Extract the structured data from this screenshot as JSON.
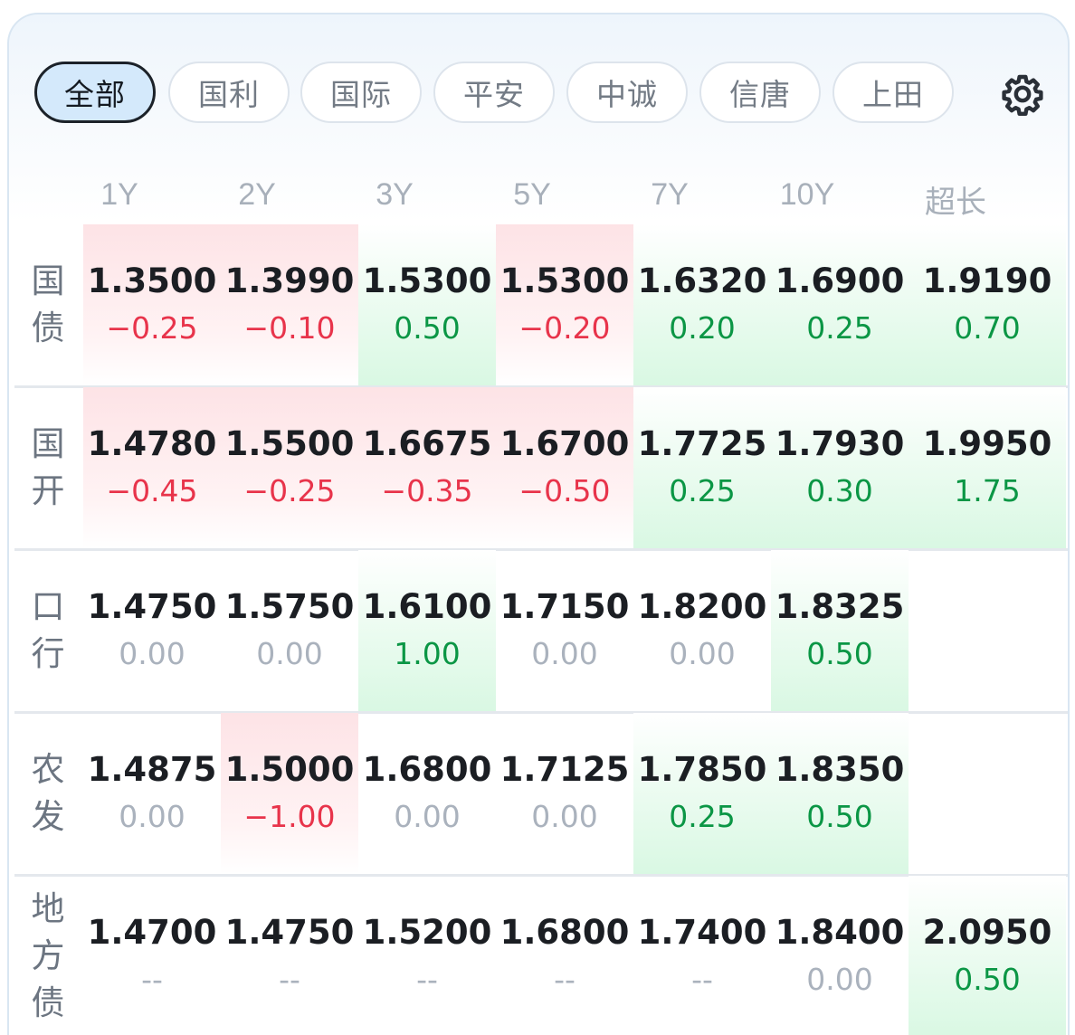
{
  "tabs": [
    {
      "label": "全部",
      "active": true
    },
    {
      "label": "国利",
      "active": false
    },
    {
      "label": "国际",
      "active": false
    },
    {
      "label": "平安",
      "active": false
    },
    {
      "label": "中诚",
      "active": false
    },
    {
      "label": "信唐",
      "active": false
    },
    {
      "label": "上田",
      "active": false
    }
  ],
  "settings_icon": "gear-icon",
  "columns": [
    "1Y",
    "2Y",
    "3Y",
    "5Y",
    "7Y",
    "10Y",
    "超长"
  ],
  "colors": {
    "up_bg": "#fde3e6",
    "down_bg": "#d9f8e3",
    "red": "#e8344b",
    "green": "#0b9645",
    "flat": "#aab2bd"
  },
  "rows": [
    {
      "label": "国债",
      "cells": [
        {
          "value": "1.3500",
          "change": "−0.25",
          "tone": "red"
        },
        {
          "value": "1.3990",
          "change": "−0.10",
          "tone": "red"
        },
        {
          "value": "1.5300",
          "change": "0.50",
          "tone": "green"
        },
        {
          "value": "1.5300",
          "change": "−0.20",
          "tone": "red"
        },
        {
          "value": "1.6320",
          "change": "0.20",
          "tone": "green"
        },
        {
          "value": "1.6900",
          "change": "0.25",
          "tone": "green"
        },
        {
          "value": "1.9190",
          "change": "0.70",
          "tone": "green"
        }
      ]
    },
    {
      "label": "国开",
      "cells": [
        {
          "value": "1.4780",
          "change": "−0.45",
          "tone": "red"
        },
        {
          "value": "1.5500",
          "change": "−0.25",
          "tone": "red"
        },
        {
          "value": "1.6675",
          "change": "−0.35",
          "tone": "red"
        },
        {
          "value": "1.6700",
          "change": "−0.50",
          "tone": "red"
        },
        {
          "value": "1.7725",
          "change": "0.25",
          "tone": "green"
        },
        {
          "value": "1.7930",
          "change": "0.30",
          "tone": "green"
        },
        {
          "value": "1.9950",
          "change": "1.75",
          "tone": "green"
        }
      ]
    },
    {
      "label": "口行",
      "cells": [
        {
          "value": "1.4750",
          "change": "0.00",
          "tone": "flat"
        },
        {
          "value": "1.5750",
          "change": "0.00",
          "tone": "flat"
        },
        {
          "value": "1.6100",
          "change": "1.00",
          "tone": "green"
        },
        {
          "value": "1.7150",
          "change": "0.00",
          "tone": "flat"
        },
        {
          "value": "1.8200",
          "change": "0.00",
          "tone": "flat"
        },
        {
          "value": "1.8325",
          "change": "0.50",
          "tone": "green"
        },
        null
      ]
    },
    {
      "label": "农发",
      "cells": [
        {
          "value": "1.4875",
          "change": "0.00",
          "tone": "flat"
        },
        {
          "value": "1.5000",
          "change": "−1.00",
          "tone": "red"
        },
        {
          "value": "1.6800",
          "change": "0.00",
          "tone": "flat"
        },
        {
          "value": "1.7125",
          "change": "0.00",
          "tone": "flat"
        },
        {
          "value": "1.7850",
          "change": "0.25",
          "tone": "green"
        },
        {
          "value": "1.8350",
          "change": "0.50",
          "tone": "green"
        },
        null
      ]
    },
    {
      "label": "地方债",
      "cells": [
        {
          "value": "1.4700",
          "change": "--",
          "tone": "flat"
        },
        {
          "value": "1.4750",
          "change": "--",
          "tone": "flat"
        },
        {
          "value": "1.5200",
          "change": "--",
          "tone": "flat"
        },
        {
          "value": "1.6800",
          "change": "--",
          "tone": "flat"
        },
        {
          "value": "1.7400",
          "change": "--",
          "tone": "flat"
        },
        {
          "value": "1.8400",
          "change": "0.00",
          "tone": "flat"
        },
        {
          "value": "2.0950",
          "change": "0.50",
          "tone": "green"
        }
      ]
    }
  ]
}
